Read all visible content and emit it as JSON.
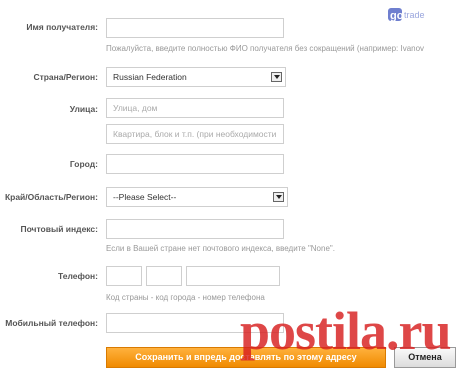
{
  "logo_text": "gotrade",
  "form": {
    "recipient": {
      "label": "Имя получателя:",
      "value": "",
      "hint": "Пожалуйста, введите полностью ФИО получателя без сокращений (например: Ivanov"
    },
    "country": {
      "label": "Страна/Регион:",
      "selected": "Russian Federation"
    },
    "street": {
      "label": "Улица:",
      "placeholder1": "Улица, дом",
      "placeholder2": "Квартира, блок и т.п. (при необходимости"
    },
    "city": {
      "label": "Город:",
      "value": ""
    },
    "region": {
      "label": "Край/Область/Регион:",
      "selected": "--Please Select--"
    },
    "zip": {
      "label": "Почтовый индекс:",
      "value": "",
      "hint": "Если в Вашей стране нет почтового индекса, введите \"None\"."
    },
    "phone": {
      "label": "Телефон:",
      "hint": "Код страны - код города - номер телефона"
    },
    "mobile": {
      "label": "Мобильный телефон:",
      "value": ""
    }
  },
  "buttons": {
    "save": "Сохранить и впредь доставлять по этому адресу",
    "cancel": "Отмена"
  },
  "watermark": "postila.ru"
}
